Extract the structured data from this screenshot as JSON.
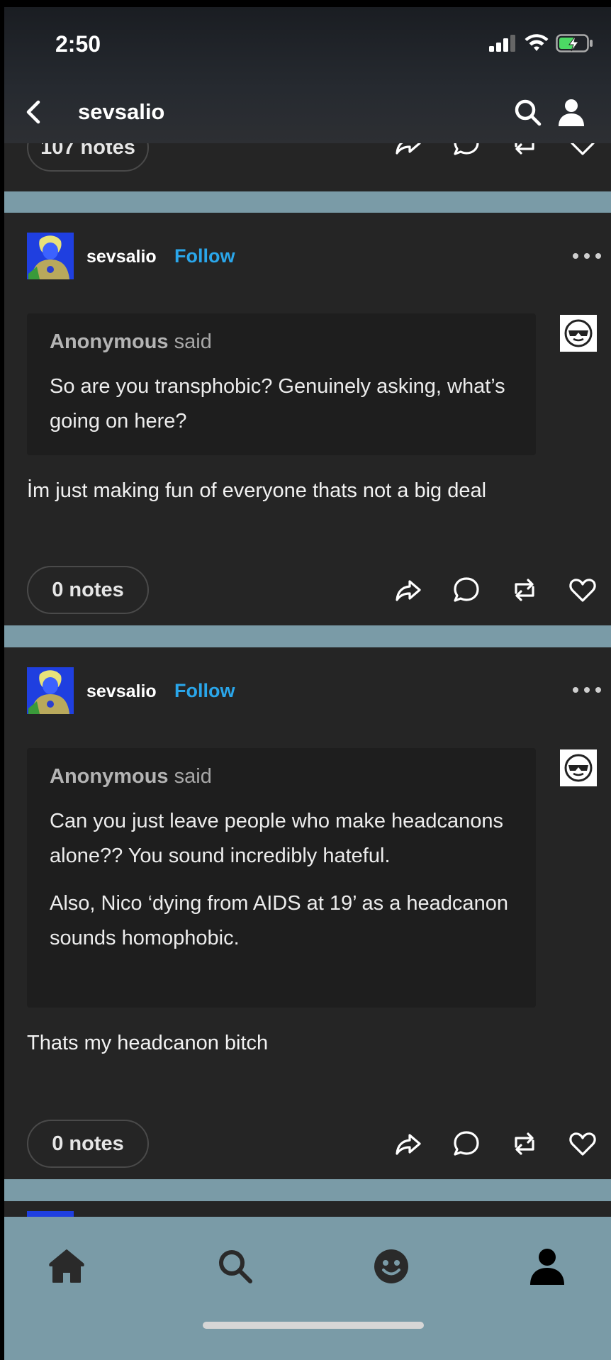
{
  "status": {
    "time": "2:50"
  },
  "header": {
    "title": "sevsalio"
  },
  "top_post": {
    "notes_label": "107 notes"
  },
  "posts": [
    {
      "username": "sevsalio",
      "follow_label": "Follow",
      "ask_name": "Anonymous",
      "ask_said": "said",
      "ask_paragraphs": [
        "So are you transphobic? Genuinely asking, what’s going on here?"
      ],
      "answer": "İm just making fun of everyone thats not a big deal",
      "notes_label": "0 notes"
    },
    {
      "username": "sevsalio",
      "follow_label": "Follow",
      "ask_name": "Anonymous",
      "ask_said": "said",
      "ask_paragraphs": [
        "Can you just leave people who make headcanons alone?? You sound incredibly hateful.",
        "Also, Nico ‘dying from AIDS at 19’ as a headcanon sounds homophobic."
      ],
      "answer": "Thats my headcanon bitch",
      "notes_label": "0 notes"
    }
  ],
  "icons": {
    "actions": [
      "share-icon",
      "reply-icon",
      "reblog-icon",
      "like-icon"
    ],
    "tabs": [
      "home-icon",
      "explore-icon",
      "activity-icon",
      "account-icon"
    ]
  },
  "colors": {
    "background": "#7a9ba7",
    "post": "#252525",
    "ask_bubble": "#1e1e1e",
    "follow": "#2aa6ea"
  }
}
